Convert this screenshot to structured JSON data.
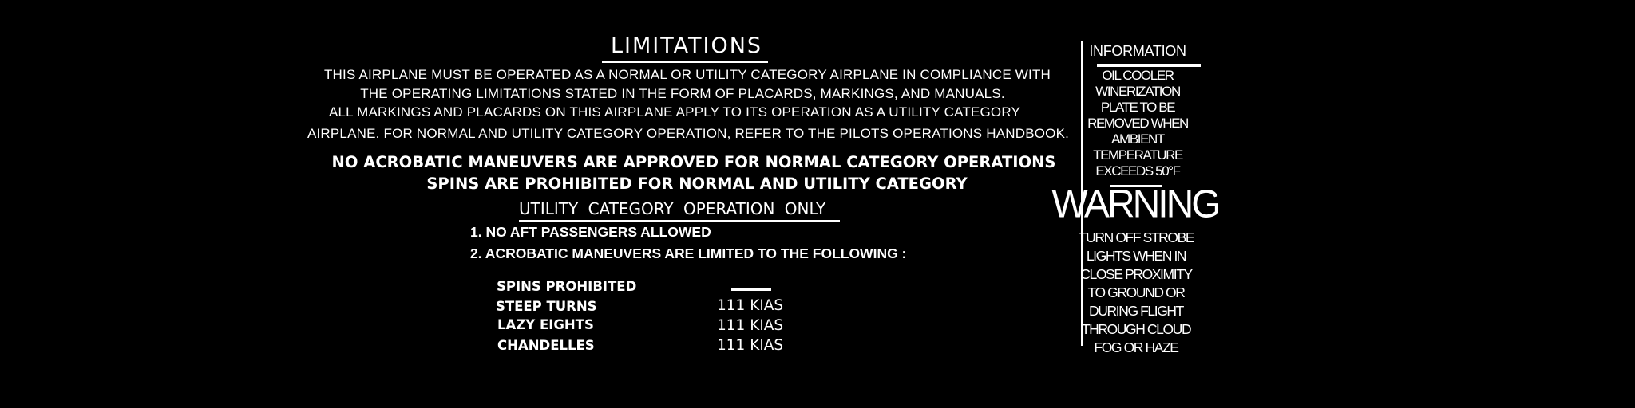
{
  "main": {
    "title": "LIMITATIONS",
    "paragraph_lines": [
      "THIS AIRPLANE MUST BE OPERATED AS A NORMAL OR UTILITY CATEGORY AIRPLANE IN COMPLIANCE WITH",
      "THE  OPERATING  LIMITATIONS STATED IN THE FORM OF PLACARDS, MARKINGS, AND MANUALS.",
      "ALL MARKINGS AND PLACARDS ON THIS AIRPLANE APPLY TO ITS OPERATION AS A UTILITY CATEGORY",
      "AIRPLANE. FOR NORMAL AND UTILITY CATEGORY OPERATION, REFER TO THE PILOTS OPERATIONS HANDBOOK."
    ],
    "bold_lines": [
      "NO ACROBATIC MANEUVERS ARE APPROVED FOR NORMAL CATEGORY OPERATIONS",
      "SPINS ARE PROHIBITED FOR NORMAL AND UTILITY CATEGORY"
    ],
    "utility_heading": "UTILITY   CATEGORY  OPERATION     ONLY",
    "numbered_items": [
      "1. NO AFT PASSENGERS ALLOWED",
      "2. ACROBATIC MANEUVERS ARE LIMITED TO THE FOLLOWING :"
    ],
    "maneuvers": [
      {
        "name": "SPINS PROHIBITED",
        "speed": ""
      },
      {
        "name": "STEEP TURNS",
        "speed": "111 KIAS"
      },
      {
        "name": "LAZY EIGHTS",
        "speed": "111 KIAS"
      },
      {
        "name": "CHANDELLES",
        "speed": "111 KIAS"
      }
    ]
  },
  "side": {
    "info_heading": "INFORMATION",
    "info_lines": [
      "OIL COOLER",
      "WINERIZATION",
      "PLATE TO BE",
      "REMOVED WHEN",
      "AMBIENT",
      "TEMPERATURE",
      "EXCEEDS 50°F"
    ],
    "warning_heading": "WARNING",
    "warning_lines": [
      "TURN OFF STROBE",
      "LIGHTS WHEN IN",
      "CLOSE PROXIMITY",
      "TO GROUND OR",
      "DURING FLIGHT",
      "THROUGH CLOUD",
      "FOG OR HAZE"
    ]
  },
  "colors": {
    "background": "#000000",
    "text": "#ffffff"
  }
}
